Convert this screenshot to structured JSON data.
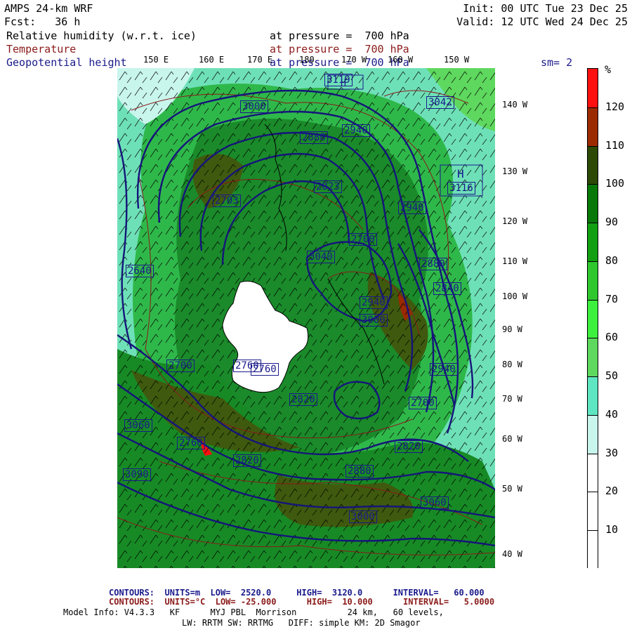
{
  "header": {
    "model": "AMPS 24-km WRF",
    "fcst": "Fcst:   36 h",
    "init": "Init: 00 UTC Tue 23 Dec 25",
    "valid": "Valid: 12 UTC Wed 24 Dec 25"
  },
  "fields": [
    {
      "name": "Relative humidity (w.r.t. ice)",
      "level": "at pressure =  700 hPa",
      "color": "#000000"
    },
    {
      "name": "Temperature",
      "level": "at pressure =  700 hPa",
      "color": "#8b1a1a"
    },
    {
      "name": "Geopotential height",
      "level": "at pressure =  700 hPa",
      "color": "#1a1a8c"
    }
  ],
  "smoothing": "sm= 2",
  "colorbar": {
    "unit": "%",
    "ticks": [
      "10",
      "20",
      "30",
      "40",
      "50",
      "60",
      "70",
      "80",
      "90",
      "100",
      "110",
      "120"
    ],
    "colors": [
      "#ffffff",
      "#ffffff",
      "#ffffff",
      "#c8f5ec",
      "#5ee6c2",
      "#5ed85e",
      "#3ef03e",
      "#2ec82e",
      "#12a012",
      "#087808",
      "#2c4a06",
      "#9c2a00",
      "#ff1010"
    ]
  },
  "longitude_labels": [
    "150 E",
    "160 E",
    "170 E",
    "180",
    "170 W",
    "160 W",
    "150 W"
  ],
  "latitude_labels": [
    "140 W",
    "130 W",
    "120 W",
    "110 W",
    "100 W",
    "90 W",
    "80 W",
    "70 W",
    "60 W",
    "50 W",
    "40 W"
  ],
  "contour_labels": [
    "3119",
    "3000",
    "2940",
    "2880",
    "3042",
    "3116",
    "2823",
    "2940",
    "2700",
    "2640",
    "2880",
    "3060",
    "2700",
    "2940",
    "2820",
    "2760",
    "2700",
    "2760",
    "2880",
    "2940",
    "3000",
    "2820",
    "3060",
    "2760",
    "2820",
    "3090",
    "3040",
    "2703",
    "3000",
    "2840"
  ],
  "footer": {
    "contours_height": "CONTOURS:  UNITS=m  LOW=  2520.0     HIGH=  3120.0      INTERVAL=   60.000",
    "contours_temp": "CONTOURS:  UNITS=°C  LOW= -25.000      HIGH=  10.000      INTERVAL=   5.0000",
    "model_info": "Model Info: V4.3.3   KF      MYJ PBL  Morrison          24 km,   60 levels,",
    "physics": "LW: RRTM SW: RRTMG   DIFF: simple KM: 2D Smagor"
  }
}
